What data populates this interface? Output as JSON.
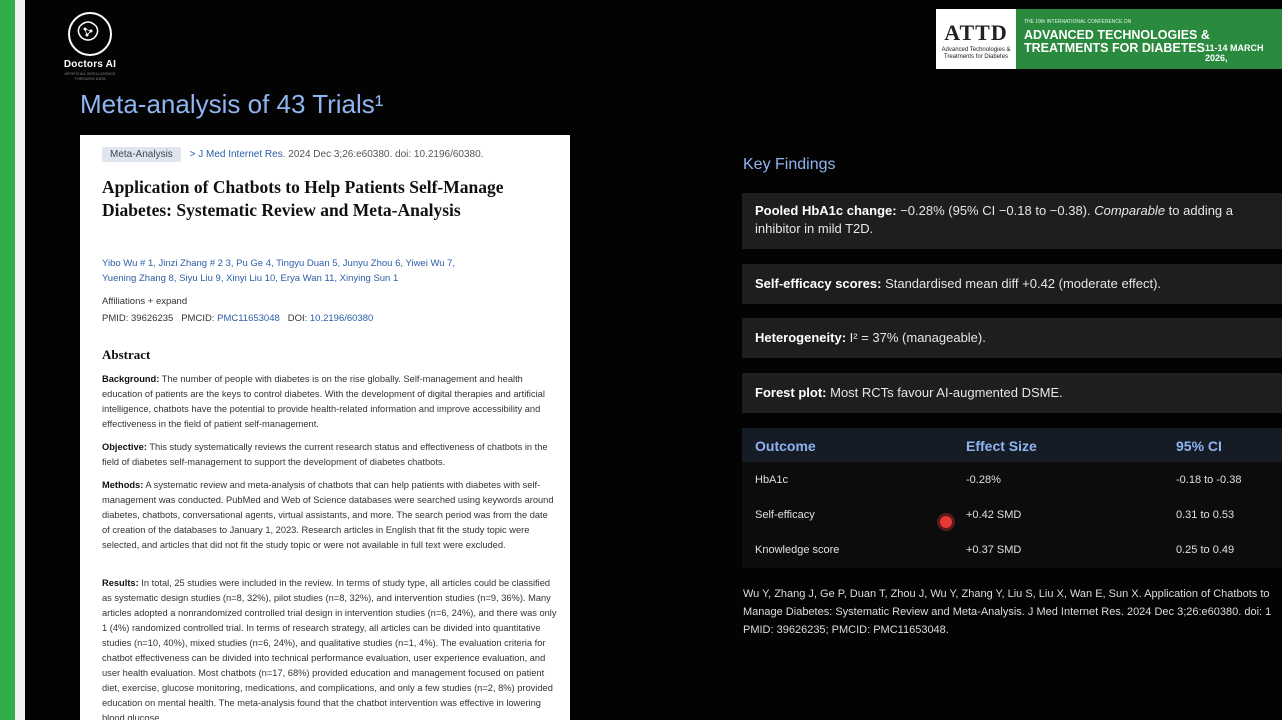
{
  "logo": {
    "name": "Doctors AI",
    "tagline": "ARTIFICIAL INTELLIGENCE THROUGH DATA"
  },
  "banner": {
    "logo_text": "ATTD",
    "logo_sub": "Advanced Technologies & Treatments for Diabetes",
    "conference": "THE 19th INTERNATIONAL CONFERENCE ON",
    "title_line1": "ADVANCED TECHNOLOGIES &",
    "title_line2": "TREATMENTS FOR DIABETES",
    "dates": "11-14 MARCH 2026,"
  },
  "slide_title": "Meta-analysis of 43 Trials¹",
  "paper": {
    "badge": "Meta-Analysis",
    "journal": "> J Med Internet Res.",
    "citation_meta": "2024 Dec 3;26:e60380. doi: 10.2196/60380.",
    "title": "Application of Chatbots to Help Patients Self-Manage Diabetes: Systematic Review and Meta-Analysis",
    "authors_line1": "Yibo Wu # 1, Jinzi Zhang # 2 3, Pu Ge 4, Tingyu Duan 5, Junyu Zhou 6, Yiwei Wu 7,",
    "authors_line2": "Yuening Zhang 8, Siyu Liu 9, Xinyi Liu 10, Erya Wan 11, Xinying Sun 1",
    "affiliations": "Affiliations  + expand",
    "pmid_label": "PMID: 39626235",
    "pmcid_label": "PMCID:",
    "pmcid": "PMC11653048",
    "doi_label": "DOI:",
    "doi": "10.2196/60380",
    "abstract_heading": "Abstract",
    "background_label": "Background:",
    "background_text": "The number of people with diabetes is on the rise globally. Self-management and health education of patients are the keys to control diabetes. With the development of digital therapies and artificial intelligence, chatbots have the potential to provide health-related information and improve accessibility and effectiveness in the field of patient self-management.",
    "objective_label": "Objective:",
    "objective_text": "This study systematically reviews the current research status and effectiveness of chatbots in the field of diabetes self-management to support the development of diabetes chatbots.",
    "methods_label": "Methods:",
    "methods_text": "A systematic review and meta-analysis of chatbots that can help patients with diabetes with self-management was conducted. PubMed and Web of Science databases were searched using keywords around diabetes, chatbots, conversational agents, virtual assistants, and more. The search period was from the date of creation of the databases to January 1, 2023. Research articles in English that fit the study topic were selected, and articles that did not fit the study topic or were not available in full text were excluded.",
    "results_label": "Results:",
    "results_text": "In total, 25 studies were included in the review. In terms of study type, all articles could be classified as systematic design studies (n=8, 32%), pilot studies (n=8, 32%), and intervention studies (n=9, 36%). Many articles adopted a nonrandomized controlled trial design in intervention studies (n=6, 24%), and there was only 1 (4%) randomized controlled trial. In terms of research strategy, all articles can be divided into quantitative studies (n=10, 40%), mixed studies (n=6, 24%), and qualitative studies (n=1, 4%). The evaluation criteria for chatbot effectiveness can be divided into technical performance evaluation, user experience evaluation, and user health evaluation. Most chatbots (n=17, 68%) provided education and management focused on patient diet, exercise, glucose monitoring, medications, and complications, and only a few studies (n=2, 8%) provided education on mental health. The meta-analysis found that the chatbot intervention was effective in lowering blood glucose"
  },
  "key_findings": {
    "title": "Key Findings",
    "items": [
      {
        "label": "Pooled HbA1c change:",
        "text": " −0.28% (95% CI −0.18 to −0.38). ",
        "emph": "Comparable",
        "text2": " to adding a",
        "line2": "inhibitor in mild T2D."
      },
      {
        "label": "Self-efficacy scores:",
        "text": " Standardised mean diff +0.42 (moderate effect)."
      },
      {
        "label": "Heterogeneity:",
        "text": " I² = 37% (manageable)."
      },
      {
        "label": "Forest plot:",
        "text": " Most RCTs favour AI-augmented DSME."
      }
    ]
  },
  "table": {
    "headers": [
      "Outcome",
      "Effect Size",
      "95% CI"
    ],
    "rows": [
      [
        "HbA1c",
        "-0.28%",
        "-0.18 to -0.38"
      ],
      [
        "Self-efficacy",
        "+0.42 SMD",
        "0.31 to 0.53"
      ],
      [
        "Knowledge score",
        "+0.37 SMD",
        "0.25 to 0.49"
      ]
    ]
  },
  "citation": {
    "line1": "Wu Y, Zhang J, Ge P, Duan T, Zhou J, Wu Y, Zhang Y, Liu S, Liu X, Wan E, Sun X. Application of Chatbots to",
    "line2": "Manage Diabetes: Systematic Review and Meta-Analysis. J Med Internet Res. 2024 Dec 3;26:e60380. doi: 1",
    "line3": "PMID: 39626235; PMCID: PMC11653048."
  },
  "colors": {
    "accent": "#8fb4f0",
    "green": "#2fae4a",
    "card": "#1e1e1e",
    "cursor": "#e53935"
  }
}
